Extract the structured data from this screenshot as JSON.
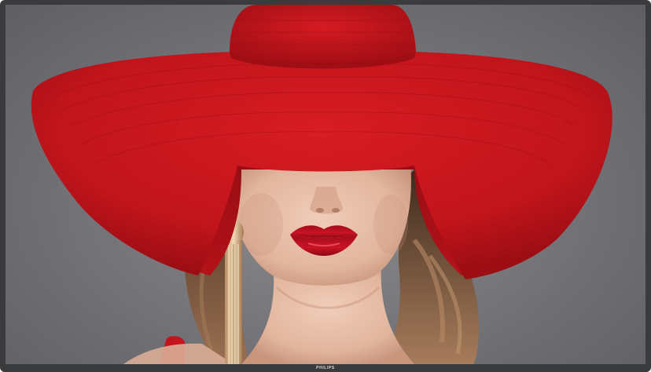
{
  "display": {
    "brand": "PHILIPS",
    "content": "photo-woman-red-hat"
  },
  "colors": {
    "bezel": "#3a3b3d",
    "background": "#77767a",
    "hat": "#c4141b",
    "lips": "#b80d1c",
    "skin": "#e8c2ad",
    "hair": "#7a5438",
    "earring": "#d9b48a",
    "dress": "#c3151e"
  }
}
